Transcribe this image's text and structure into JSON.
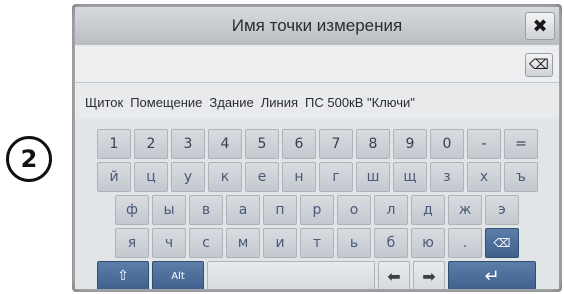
{
  "step_badge": "2",
  "dialog": {
    "title": "Имя точки измерения",
    "close_symbol": "✖",
    "clear_symbol": "⌫",
    "input_value": ""
  },
  "suggestions": [
    "Щиток",
    "Помещение",
    "Здание",
    "Линия",
    "ПС 500кВ \"Ключи\""
  ],
  "keyboard": {
    "row1": [
      "1",
      "2",
      "3",
      "4",
      "5",
      "6",
      "7",
      "8",
      "9",
      "0",
      "-",
      "="
    ],
    "row2": [
      "й",
      "ц",
      "у",
      "к",
      "е",
      "н",
      "г",
      "ш",
      "щ",
      "з",
      "х",
      "ъ"
    ],
    "row3": [
      "ф",
      "ы",
      "в",
      "а",
      "п",
      "р",
      "о",
      "л",
      "д",
      "ж",
      "э"
    ],
    "row4": [
      "я",
      "ч",
      "с",
      "м",
      "и",
      "т",
      "ь",
      "б",
      "ю",
      "."
    ],
    "backspace_symbol": "⌫",
    "shift_symbol": "⇧",
    "alt_label": "Alt",
    "left_arrow_symbol": "⬅",
    "right_arrow_symbol": "➡",
    "enter_symbol": "↵"
  }
}
